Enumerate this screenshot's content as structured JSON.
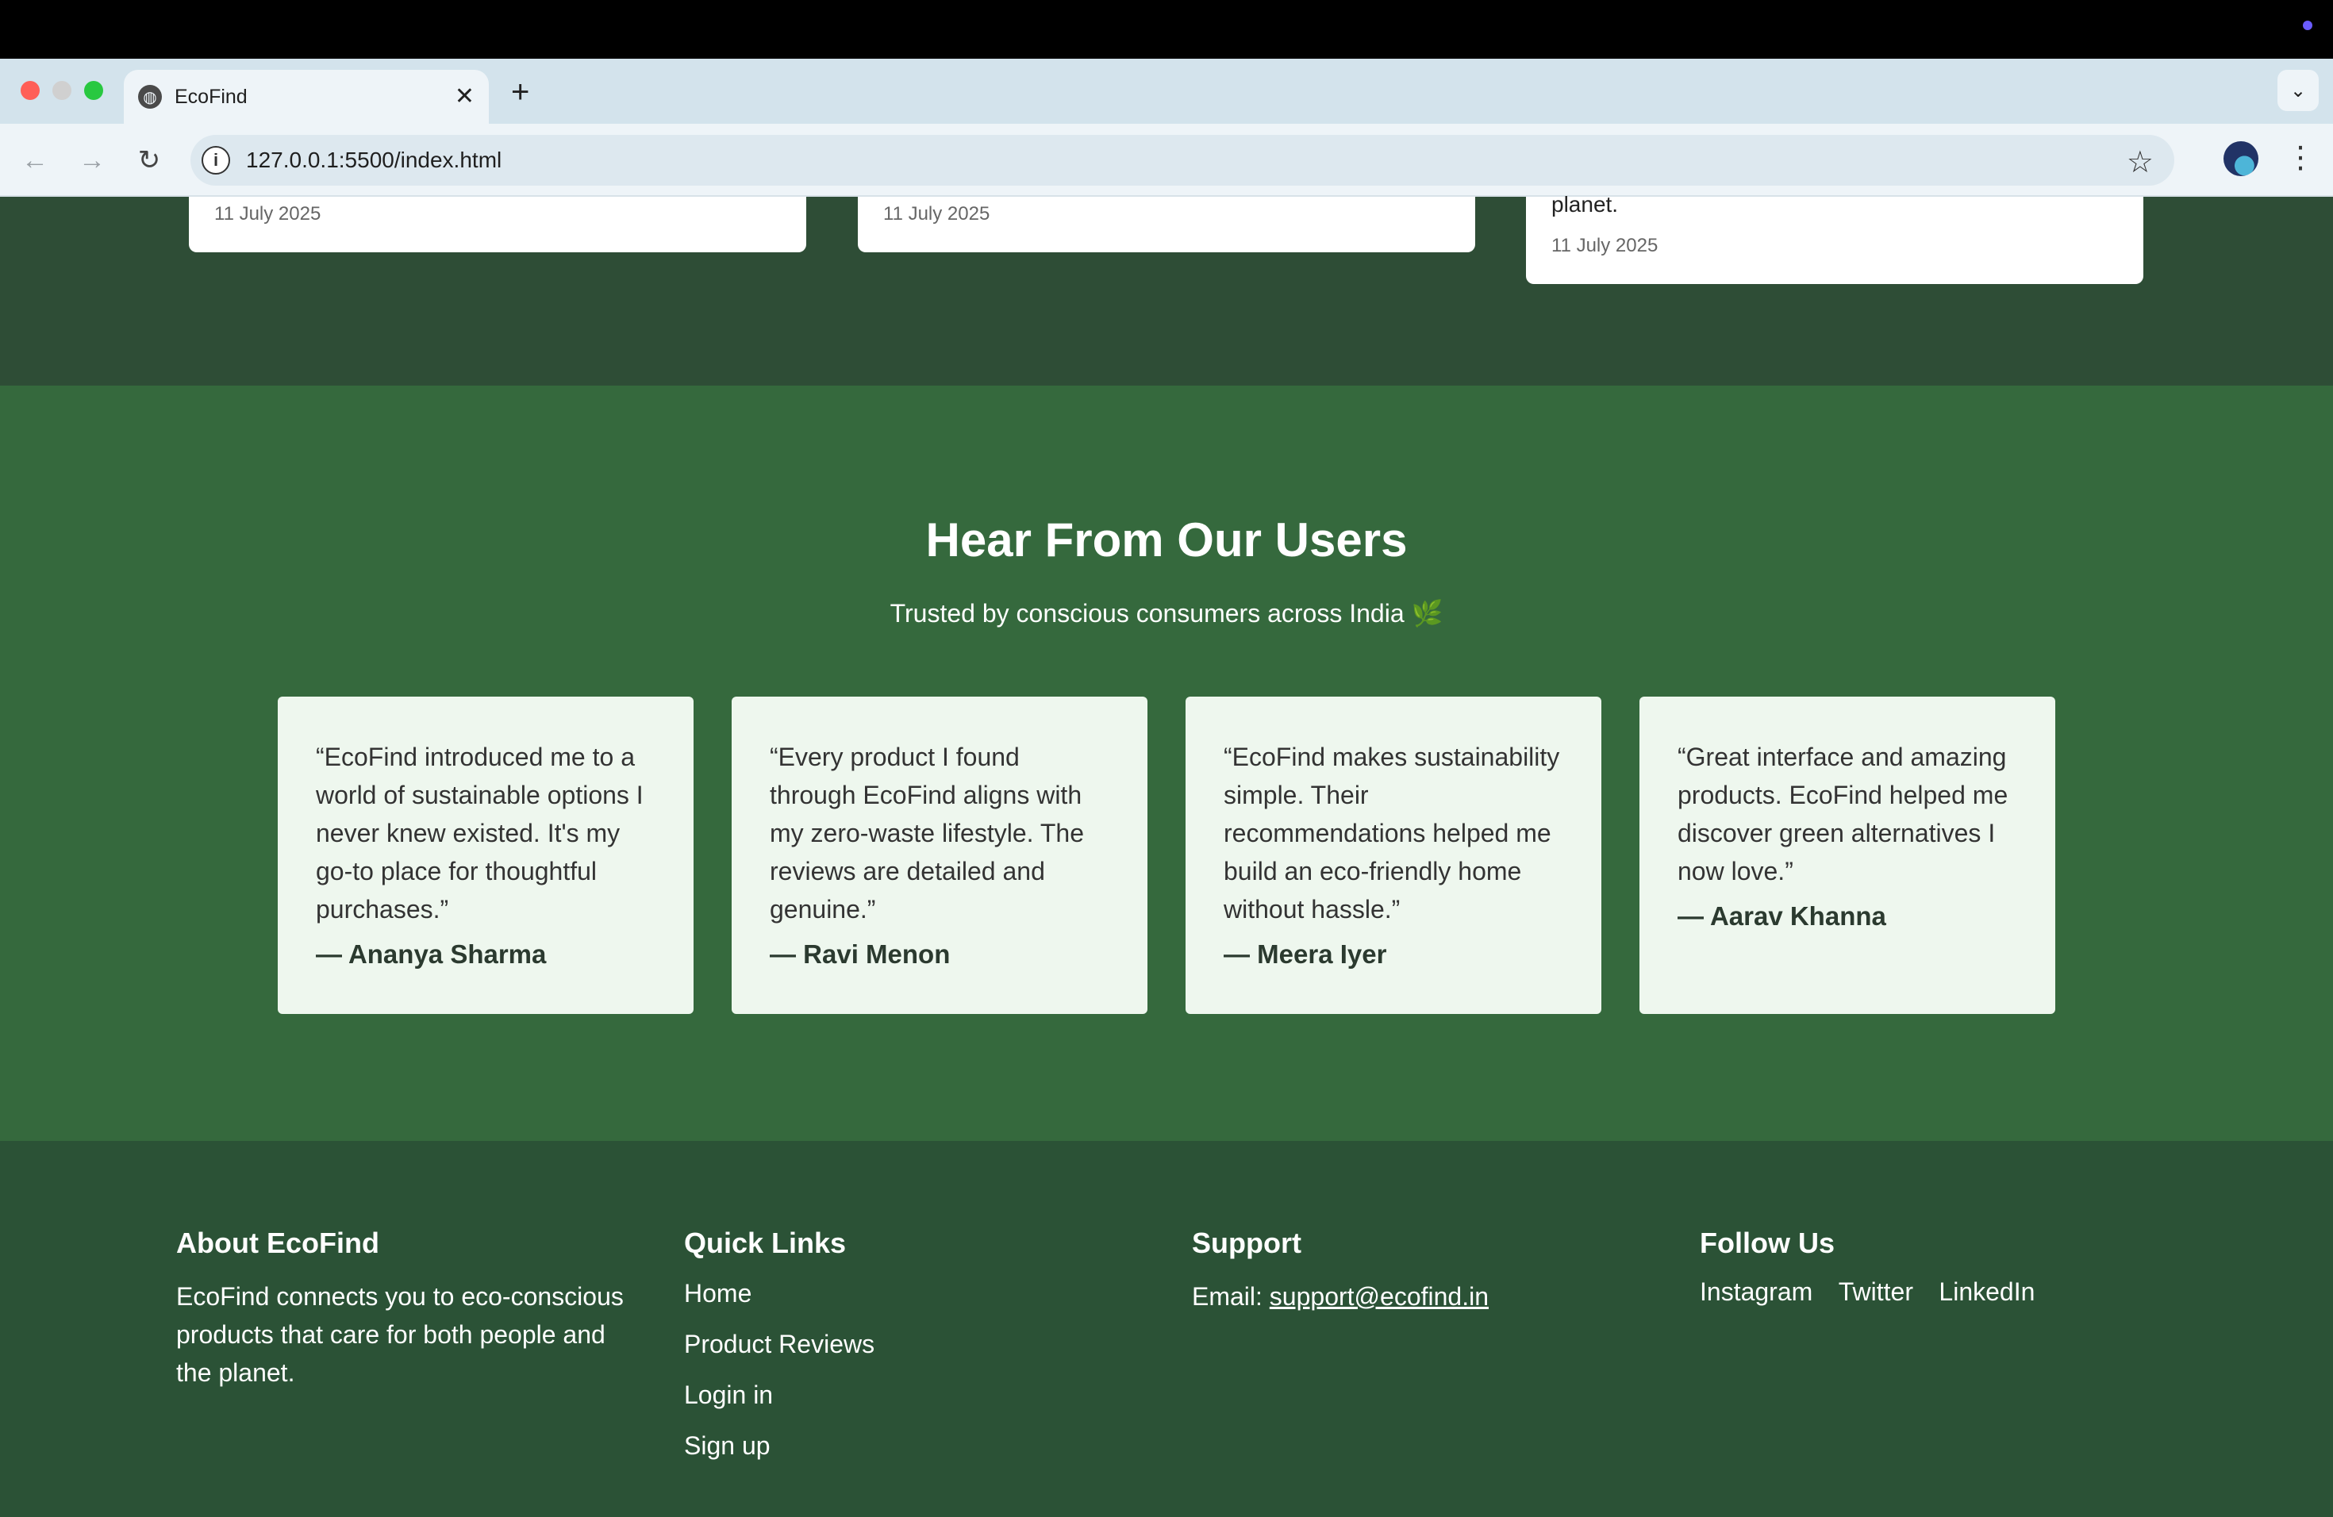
{
  "browser": {
    "tab_title": "EcoFind",
    "url": "127.0.0.1:5500/index.html"
  },
  "blog": {
    "cards": [
      {
        "date": "11 July 2025"
      },
      {
        "date": "11 July 2025"
      },
      {
        "tail_text": "planet.",
        "date": "11 July 2025"
      }
    ]
  },
  "testimonials": {
    "title": "Hear From Our Users",
    "subtitle": "Trusted by conscious consumers across India",
    "subtitle_emoji": "🌿",
    "items": [
      {
        "quote": "“EcoFind introduced me to a world of sustainable options I never knew existed. It's my go-to place for thoughtful purchases.”",
        "author": "— Ananya Sharma"
      },
      {
        "quote": "“Every product I found through EcoFind aligns with my zero-waste lifestyle. The reviews are detailed and genuine.”",
        "author": "— Ravi Menon"
      },
      {
        "quote": "“EcoFind makes sustainability simple. Their recommendations helped me build an eco-friendly home without hassle.”",
        "author": "— Meera Iyer"
      },
      {
        "quote": "“Great interface and amazing products. EcoFind helped me discover green alternatives I now love.”",
        "author": "— Aarav Khanna"
      }
    ]
  },
  "footer": {
    "about": {
      "heading": "About EcoFind",
      "text": "EcoFind connects you to eco-conscious products that care for both people and the planet."
    },
    "quick_links": {
      "heading": "Quick Links",
      "links": [
        "Home",
        "Product Reviews",
        "Login in",
        "Sign up"
      ]
    },
    "support": {
      "heading": "Support",
      "email_label": "Email: ",
      "email": "support@ecofind.in"
    },
    "follow": {
      "heading": "Follow Us",
      "links": [
        "Instagram",
        "Twitter",
        "LinkedIn"
      ]
    }
  }
}
